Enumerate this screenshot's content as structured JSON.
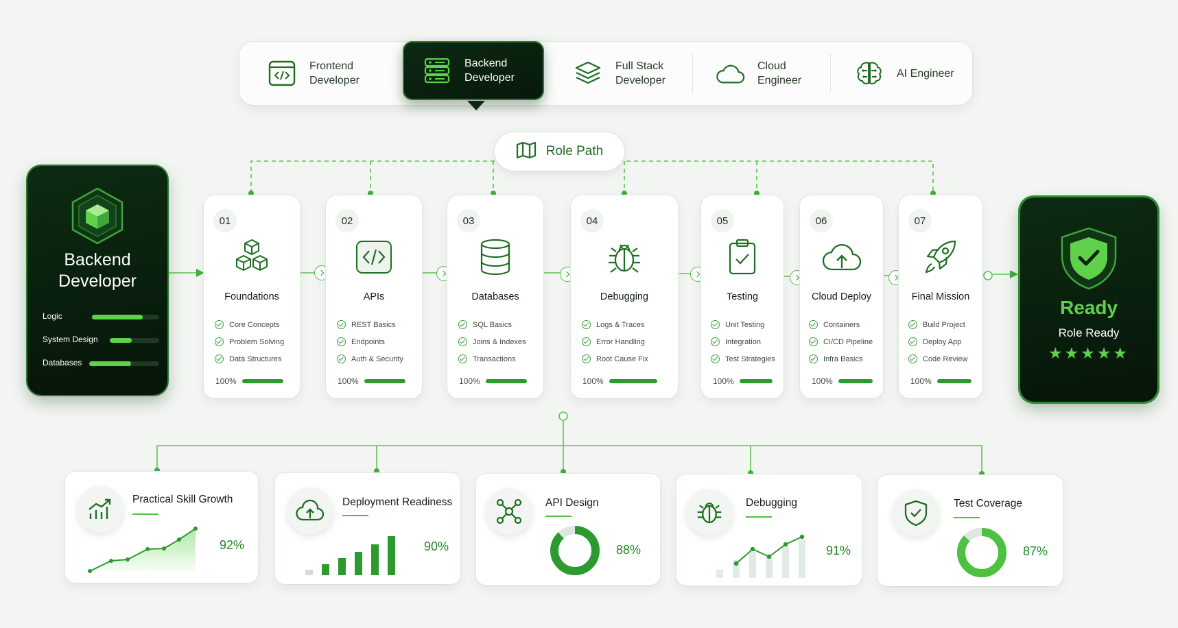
{
  "colors": {
    "accent": "#34a23a",
    "accent_light": "#5fd14a",
    "dark": "#0a2210",
    "background": "#f3f5f3"
  },
  "roles": [
    {
      "label": "Frontend\nDeveloper",
      "icon": "code-window-icon",
      "active": false
    },
    {
      "label": "Backend\nDeveloper",
      "icon": "server-icon",
      "active": true
    },
    {
      "label": "Full Stack\nDeveloper",
      "icon": "layers-icon",
      "active": false
    },
    {
      "label": "Cloud\nEngineer",
      "icon": "cloud-icon",
      "active": false
    },
    {
      "label": "AI Engineer",
      "icon": "brain-icon",
      "active": false
    }
  ],
  "role_path": {
    "label": "Role Path",
    "icon": "map-icon"
  },
  "profile": {
    "title": "Backend\nDeveloper",
    "icon": "cube-icon",
    "skills": [
      {
        "label": "Logic",
        "level": 0.75
      },
      {
        "label": "System Design",
        "level": 0.45
      },
      {
        "label": "Databases",
        "level": 0.6
      }
    ]
  },
  "steps": [
    {
      "num": "01",
      "title": "Foundations",
      "icon": "cubes-icon",
      "items": [
        "Core Concepts",
        "Problem Solving",
        "Data Structures"
      ],
      "progress": "100%"
    },
    {
      "num": "02",
      "title": "APIs",
      "icon": "code-brackets-icon",
      "items": [
        "REST Basics",
        "Endpoints",
        "Auth & Security"
      ],
      "progress": "100%"
    },
    {
      "num": "03",
      "title": "Databases",
      "icon": "database-icon",
      "items": [
        "SQL Basics",
        "Joins & Indexes",
        "Transactions"
      ],
      "progress": "100%"
    },
    {
      "num": "04",
      "title": "Debugging",
      "icon": "bug-icon",
      "items": [
        "Logs & Traces",
        "Error Handling",
        "Root Cause Fix"
      ],
      "progress": "100%"
    },
    {
      "num": "05",
      "title": "Testing",
      "icon": "clipboard-check-icon",
      "items": [
        "Unit Testing",
        "Integration",
        "Test Strategies"
      ],
      "progress": "100%"
    },
    {
      "num": "06",
      "title": "Cloud Deploy",
      "icon": "cloud-upload-icon",
      "items": [
        "Containers",
        "CI/CD Pipeline",
        "Infra Basics"
      ],
      "progress": "100%"
    },
    {
      "num": "07",
      "title": "Final Mission",
      "icon": "rocket-icon",
      "items": [
        "Build Project",
        "Deploy App",
        "Code Review"
      ],
      "progress": "100%"
    }
  ],
  "ready": {
    "title": "Ready",
    "subtitle": "Role Ready",
    "stars": "★★★★★",
    "rating": 5,
    "icon": "shield-check-icon"
  },
  "metrics": [
    {
      "title": "Practical Skill Growth",
      "value": "92%",
      "icon": "growth-chart-icon",
      "visual": "line-area"
    },
    {
      "title": "Deployment Readiness",
      "value": "90%",
      "icon": "cloud-upload-icon",
      "visual": "bars"
    },
    {
      "title": "API Design",
      "value": "88%",
      "icon": "network-icon",
      "visual": "donut",
      "fraction": 0.88
    },
    {
      "title": "Debugging",
      "value": "91%",
      "icon": "bug-icon",
      "visual": "line-bars"
    },
    {
      "title": "Test Coverage",
      "value": "87%",
      "icon": "shield-check-icon",
      "visual": "donut",
      "fraction": 0.87
    }
  ]
}
